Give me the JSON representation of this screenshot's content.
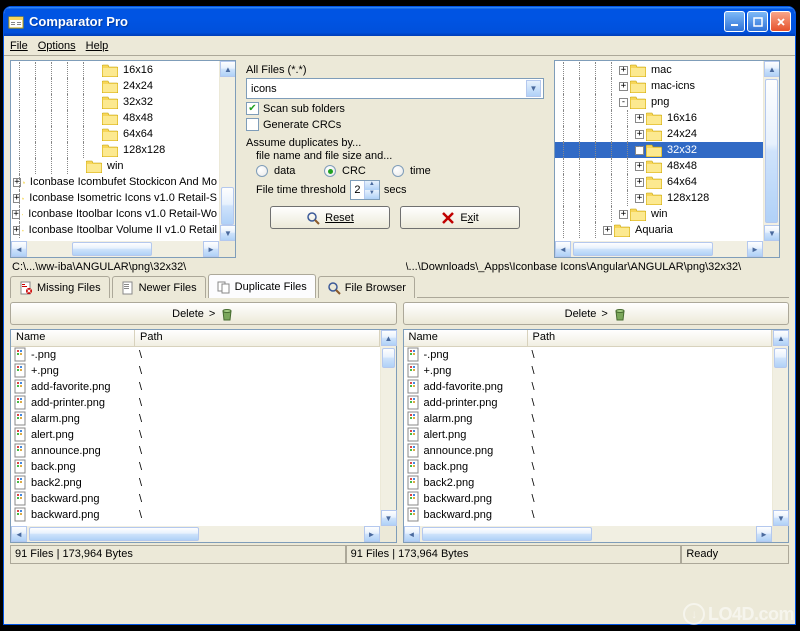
{
  "window": {
    "title": "Comparator Pro"
  },
  "menu": {
    "file": "File",
    "options": "Options",
    "help": "Help"
  },
  "left_tree": {
    "rows": [
      {
        "indent": 5,
        "expander": "",
        "label": "16x16"
      },
      {
        "indent": 5,
        "expander": "",
        "label": "24x24"
      },
      {
        "indent": 5,
        "expander": "",
        "label": "32x32"
      },
      {
        "indent": 5,
        "expander": "",
        "label": "48x48"
      },
      {
        "indent": 5,
        "expander": "",
        "label": "64x64"
      },
      {
        "indent": 5,
        "expander": "",
        "label": "128x128"
      },
      {
        "indent": 4,
        "expander": "",
        "label": "win"
      },
      {
        "indent": 1,
        "expander": "+",
        "label": "Iconbase Icombufet Stockicon And Mo"
      },
      {
        "indent": 1,
        "expander": "+",
        "label": "Iconbase Isometric Icons v1.0 Retail-S"
      },
      {
        "indent": 1,
        "expander": "+",
        "label": "Iconbase Itoolbar Icons v1.0 Retail-Wo"
      },
      {
        "indent": 1,
        "expander": "+",
        "label": "Iconbase Itoolbar Volume II v1.0 Retail"
      }
    ]
  },
  "right_tree": {
    "rows": [
      {
        "indent": 4,
        "expander": "+",
        "label": "mac",
        "sel": false
      },
      {
        "indent": 4,
        "expander": "+",
        "label": "mac-icns",
        "sel": false
      },
      {
        "indent": 4,
        "expander": "-",
        "label": "png",
        "sel": false
      },
      {
        "indent": 5,
        "expander": "+",
        "label": "16x16",
        "sel": false
      },
      {
        "indent": 5,
        "expander": "+",
        "label": "24x24",
        "sel": false
      },
      {
        "indent": 5,
        "expander": "+",
        "label": "32x32",
        "sel": true
      },
      {
        "indent": 5,
        "expander": "+",
        "label": "48x48",
        "sel": false
      },
      {
        "indent": 5,
        "expander": "+",
        "label": "64x64",
        "sel": false
      },
      {
        "indent": 5,
        "expander": "+",
        "label": "128x128",
        "sel": false
      },
      {
        "indent": 4,
        "expander": "+",
        "label": "win",
        "sel": false
      },
      {
        "indent": 3,
        "expander": "+",
        "label": "Aquaria",
        "sel": false
      }
    ]
  },
  "filter": {
    "label": "All Files (*.*)",
    "combo_value": "icons",
    "scan_sub": {
      "label": "Scan sub folders",
      "checked": true
    },
    "gen_crc": {
      "label": "Generate CRCs",
      "checked": false
    },
    "assume_label": "Assume duplicates by...",
    "assume_sub": "file name and file size and...",
    "r_data": "data",
    "r_crc": "CRC",
    "r_time": "time",
    "thresh_label": "File time threshold",
    "thresh_val": "2",
    "thresh_unit": "secs",
    "reset": "Reset",
    "exit": "Exit"
  },
  "paths": {
    "left": "C:\\...\\ww-iba\\ANGULAR\\png\\32x32\\",
    "right": "\\...\\Downloads\\_Apps\\Iconbase Icons\\Angular\\ANGULAR\\png\\32x32\\"
  },
  "tabs": {
    "missing": "Missing Files",
    "newer": "Newer Files",
    "duplicate": "Duplicate Files",
    "browser": "File Browser"
  },
  "delete_label": "Delete",
  "list_headers": {
    "name": "Name",
    "path": "Path"
  },
  "files": [
    {
      "name": "-.png"
    },
    {
      "name": "+.png"
    },
    {
      "name": "add-favorite.png"
    },
    {
      "name": "add-printer.png"
    },
    {
      "name": "alarm.png"
    },
    {
      "name": "alert.png"
    },
    {
      "name": "announce.png"
    },
    {
      "name": "back.png"
    },
    {
      "name": "back2.png"
    },
    {
      "name": "backward.png"
    },
    {
      "name": "backward.png"
    }
  ],
  "status": {
    "left": "91 Files  |  173,964 Bytes",
    "right": "91 Files  |  173,964 Bytes",
    "ready": "Ready"
  },
  "watermark": "LO4D.com"
}
